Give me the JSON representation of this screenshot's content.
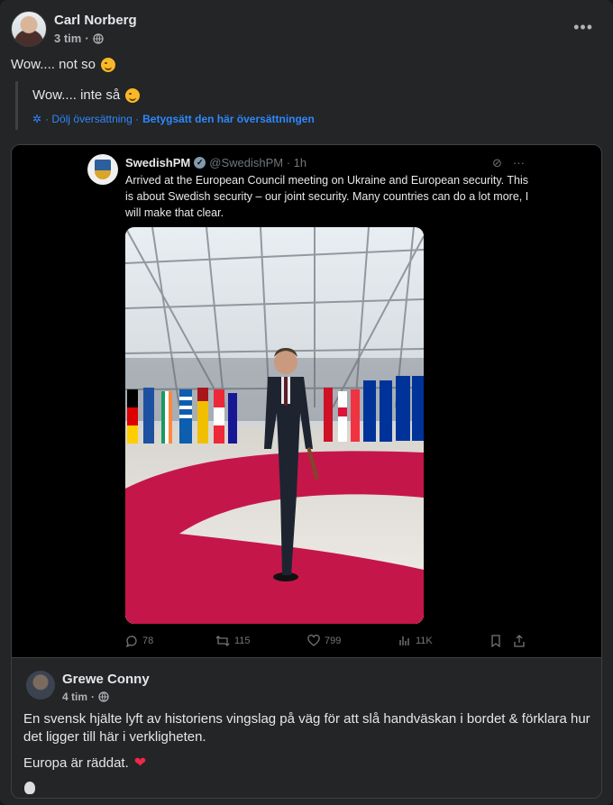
{
  "post": {
    "author": "Carl Norberg",
    "time": "3 tim",
    "separator": "·",
    "text": "Wow.... not so",
    "translation": {
      "text": "Wow.... inte så",
      "hide_label": "· Dölj översättning ·",
      "rate_label": "Betygsätt den här översättningen"
    },
    "more_label": "•••"
  },
  "tweet": {
    "name": "SwedishPM",
    "handle": "@SwedishPM · 1h",
    "text": "Arrived at the European Council meeting on Ukraine and European security. This is about Swedish security – our joint security. Many countries can do a lot more, I will make that clear.",
    "actions": {
      "replies": "78",
      "retweets": "115",
      "likes": "799",
      "views": "11K"
    }
  },
  "comment": {
    "author": "Grewe Conny",
    "time": "4 tim",
    "separator": "·",
    "text": "En svensk hjälte lyft av historiens vingslag på väg för att slå handväskan i bordet & förklara hur det ligger till här i verkligheten.",
    "text2": "Europa är räddat."
  },
  "colors": {
    "background": "#242526",
    "link": "#2d88ff",
    "carpet": "#c5164a",
    "heart": "#f02849"
  },
  "icons": [
    "globe-icon",
    "more-icon",
    "smile-emoji-icon",
    "gear-icon",
    "verified-badge-icon",
    "grok-icon",
    "reply-icon",
    "retweet-icon",
    "like-icon",
    "views-icon",
    "bookmark-icon",
    "share-icon",
    "heart-icon"
  ]
}
